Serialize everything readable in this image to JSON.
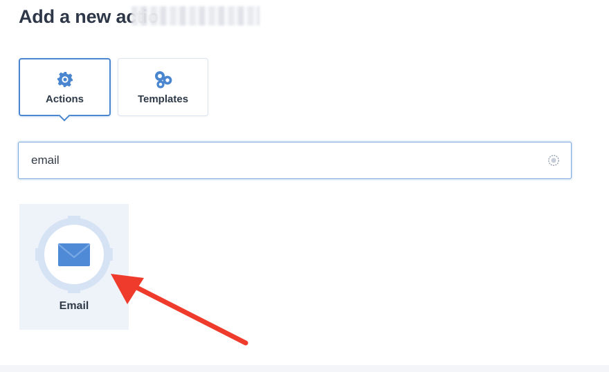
{
  "header": {
    "title": "Add a new actio"
  },
  "tabs": [
    {
      "label": "Actions",
      "icon": "gear-icon",
      "selected": true
    },
    {
      "label": "Templates",
      "icon": "gears-icon",
      "selected": false
    }
  ],
  "search": {
    "value": "email",
    "clear_icon": "clear-icon"
  },
  "results": [
    {
      "label": "Email",
      "icon": "envelope-gear-icon"
    }
  ],
  "colors": {
    "accent": "#4a86d0",
    "card_background": "#eef3f9",
    "annotation": "#ee3b2b"
  }
}
